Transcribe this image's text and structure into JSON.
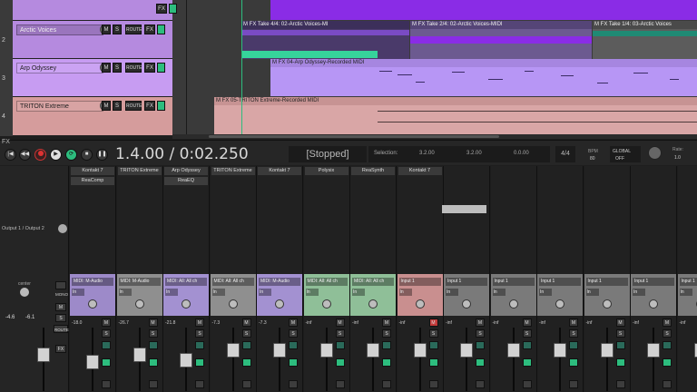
{
  "tracks": [
    {
      "num": "",
      "name": "",
      "color": "#b58adf",
      "fx_label": "FX"
    },
    {
      "num": "2",
      "name": "Arctic Voices",
      "color": "#b58adf",
      "m": "M",
      "s": "S",
      "route": "ROUTE",
      "fx_label": "FX"
    },
    {
      "num": "3",
      "name": "Arp Odyssey",
      "color": "#c79cf2",
      "m": "M",
      "s": "S",
      "route": "ROUTE",
      "fx_label": "FX"
    },
    {
      "num": "4",
      "name": "TRITON Extreme",
      "color": "#d59c9c",
      "m": "M",
      "s": "S",
      "route": "ROUTE",
      "fx_label": "FX"
    }
  ],
  "items": {
    "take4": "M FX Take 4/4: 02-Arctic Voices-MI",
    "take2": "M FX Take 2/4: 02-Arctic Voices-MIDI",
    "take1": "M FX Take 1/4: 03-Arctic Voices",
    "arp": "M FX 04-Arp Odyssey-Recorded MIDI",
    "triton": "M FX 05-TRITON Extreme-Recorded MIDI"
  },
  "transport": {
    "fx": "FX",
    "time": "1.4.00 / 0:02.250",
    "status": "[Stopped]",
    "selection_label": "Selection:",
    "sel_start": "3.2.00",
    "sel_end": "3.2.00",
    "sel_len": "0.0.00",
    "timesig": "4/4",
    "bpm_label": "BPM",
    "bpm_value": "80",
    "global": "GLOBAL",
    "global_state": "OFF",
    "rate_label": "Rate:",
    "rate_value": "1.0"
  },
  "master": {
    "output": "Output 1 / Output 2",
    "center": "center",
    "mono": "MONO",
    "route": "ROUTE",
    "m": "M",
    "s": "S",
    "fx": "FX",
    "vol_l": "-4.6",
    "vol_r": "-6.1"
  },
  "strips": [
    {
      "name": "Kontakt 7",
      "fx": "ReaComp",
      "io": "MIDI: M-Audio",
      "ch": "In",
      "vol": "-18.0",
      "color": "#9d8ac9",
      "m": "M",
      "s": "S",
      "fader": 0.45
    },
    {
      "name": "TRITON Extreme",
      "fx": "",
      "io": "MIDI: M-Audio",
      "ch": "In",
      "vol": "-26.7",
      "color": "#8f8f8f",
      "m": "M",
      "s": "S",
      "fader": 0.6
    },
    {
      "name": "Arp Odyssey",
      "fx": "ReaEQ",
      "io": "MIDI: All: All ch",
      "ch": "In",
      "vol": "-21.8",
      "color": "#a391d1",
      "m": "M",
      "s": "S",
      "fader": 0.5
    },
    {
      "name": "TRITON Extreme",
      "fx": "",
      "io": "MIDI: All: All ch",
      "ch": "In",
      "vol": "-7.3",
      "color": "#8f8f8f",
      "m": "M",
      "s": "S",
      "fader": 0.7
    },
    {
      "name": "Kontakt 7",
      "fx": "",
      "io": "MIDI: M-Audio",
      "ch": "In",
      "vol": "-7.3",
      "color": "#a391d1",
      "m": "M",
      "s": "S",
      "fader": 0.7
    },
    {
      "name": "Polysix",
      "fx": "",
      "io": "MIDI: All: All ch",
      "ch": "In",
      "vol": "-inf",
      "color": "#8fbf98",
      "m": "M",
      "s": "S",
      "fader": 0.7
    },
    {
      "name": "ReaSynth",
      "fx": "",
      "io": "MIDI: All: All ch",
      "ch": "In",
      "vol": "-inf",
      "color": "#8fbf98",
      "m": "M",
      "s": "S",
      "fader": 0.7
    },
    {
      "name": "Kontakt 7",
      "fx": "",
      "io": "Input 1",
      "ch": "In",
      "vol": "-inf",
      "color": "#c98f8f",
      "m": "M",
      "s": "S",
      "fader": 0.7
    },
    {
      "name": "",
      "fx": "",
      "io": "Input 1",
      "ch": "In",
      "vol": "-inf",
      "color": "#7a7a7a",
      "m": "M",
      "s": "S",
      "fader": 0.7
    },
    {
      "name": "",
      "fx": "",
      "io": "Input 1",
      "ch": "In",
      "vol": "-inf",
      "color": "#7a7a7a",
      "m": "M",
      "s": "S",
      "fader": 0.7
    },
    {
      "name": "",
      "fx": "",
      "io": "Input 1",
      "ch": "In",
      "vol": "-inf",
      "color": "#7a7a7a",
      "m": "M",
      "s": "S",
      "fader": 0.7
    },
    {
      "name": "",
      "fx": "",
      "io": "Input 1",
      "ch": "In",
      "vol": "-inf",
      "color": "#7a7a7a",
      "m": "M",
      "s": "S",
      "fader": 0.7
    },
    {
      "name": "",
      "fx": "",
      "io": "Input 1",
      "ch": "In",
      "vol": "-inf",
      "color": "#7a7a7a",
      "m": "M",
      "s": "S",
      "fader": 0.7
    },
    {
      "name": "",
      "fx": "",
      "io": "Input 1",
      "ch": "In",
      "vol": "-inf",
      "color": "#7a7a7a",
      "m": "M",
      "s": "S",
      "fader": 0.7
    }
  ]
}
